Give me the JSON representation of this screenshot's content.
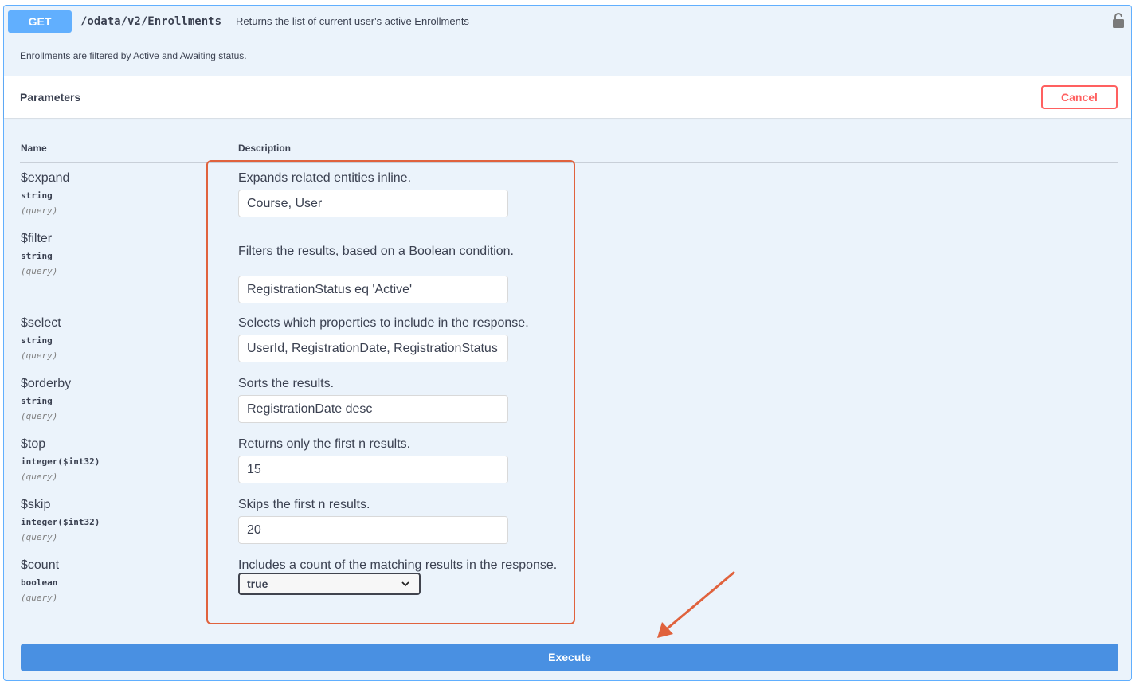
{
  "operation": {
    "method": "GET",
    "path": "/odata/v2/Enrollments",
    "summary": "Returns the list of current user's active Enrollments",
    "description": "Enrollments are filtered by Active and Awaiting status.",
    "lock_icon": "lock-icon"
  },
  "parameters_section": {
    "title": "Parameters",
    "cancel_label": "Cancel",
    "col_name": "Name",
    "col_description": "Description"
  },
  "params": [
    {
      "name": "$expand",
      "type": "string",
      "in": "(query)",
      "description": "Expands related entities inline.",
      "value": "Course, User"
    },
    {
      "name": "$filter",
      "type": "string",
      "in": "(query)",
      "description": "Filters the results, based on a Boolean condition.",
      "value": "RegistrationStatus eq 'Active'"
    },
    {
      "name": "$select",
      "type": "string",
      "in": "(query)",
      "description": "Selects which properties to include in the response.",
      "value": "UserId, RegistrationDate, RegistrationStatus"
    },
    {
      "name": "$orderby",
      "type": "string",
      "in": "(query)",
      "description": "Sorts the results.",
      "value": "RegistrationDate desc"
    },
    {
      "name": "$top",
      "type": "integer($int32)",
      "in": "(query)",
      "description": "Returns only the first n results.",
      "value": "15"
    },
    {
      "name": "$skip",
      "type": "integer($int32)",
      "in": "(query)",
      "description": "Skips the first n results.",
      "value": "20"
    },
    {
      "name": "$count",
      "type": "boolean",
      "in": "(query)",
      "description": "Includes a count of the matching results in the response.",
      "value": "true"
    }
  ],
  "execute_label": "Execute",
  "colors": {
    "get_method": "#61affe",
    "cancel": "#ff6060",
    "execute": "#4990e2",
    "annotation": "#e0623d"
  }
}
